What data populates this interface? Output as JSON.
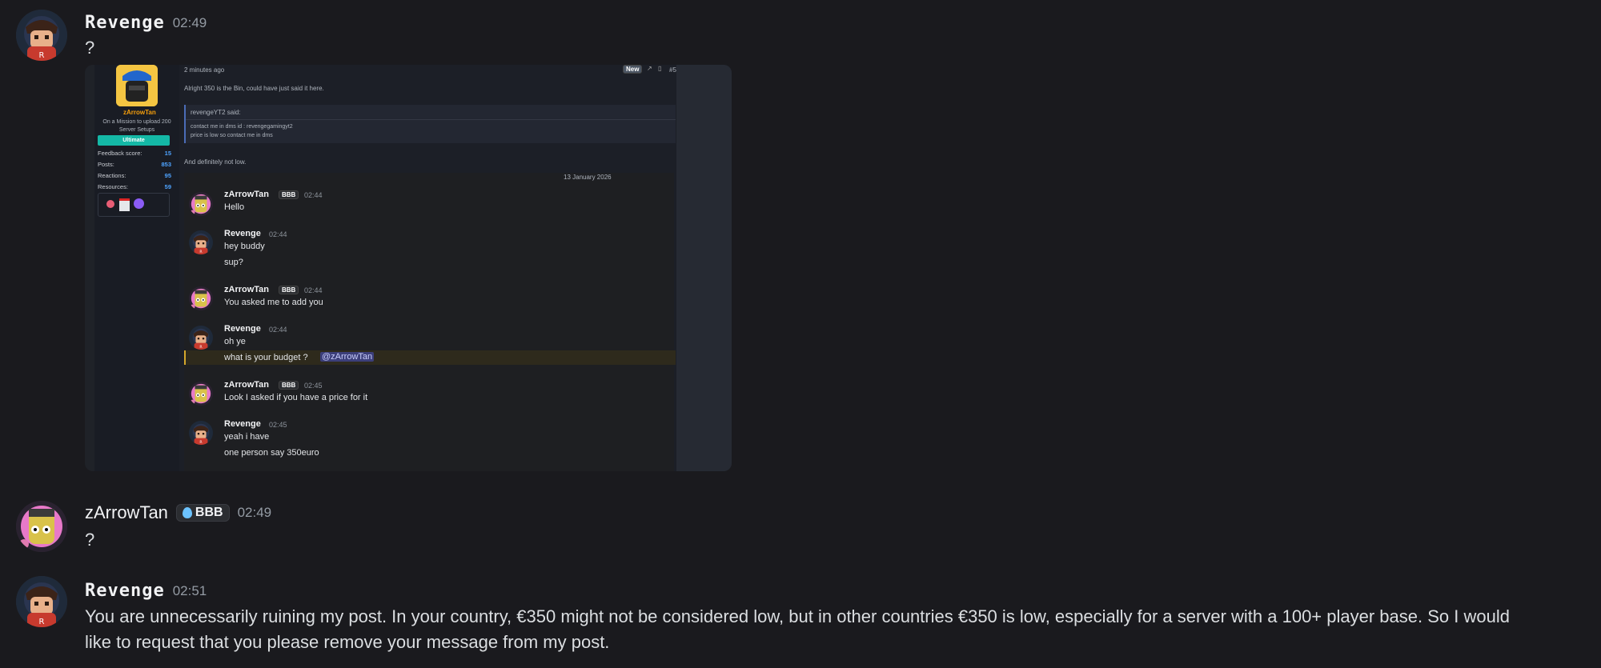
{
  "messages": [
    {
      "author": "Revenge",
      "time": "02:49",
      "text": "?"
    },
    {
      "author": "zArrowTan",
      "tag": "BBB",
      "time": "02:49",
      "text": "?"
    },
    {
      "author": "Revenge",
      "time": "02:51",
      "text_line1": "You are unnecessarily ruining my post. In your country, €350 might not be considered low, but in other countries €350 is low, especially for a server with a 100+ player base. So I would",
      "text_line2": "like to request that you please remove your message from my post."
    }
  ],
  "embed": {
    "profile": {
      "name": "zArrowTan",
      "subtitle_line1": "On a Mission to upload 200",
      "subtitle_line2": "Server Setups",
      "rank": "Ultimate",
      "stats": [
        {
          "label": "Feedback score:",
          "value": "15"
        },
        {
          "label": "Posts:",
          "value": "853"
        },
        {
          "label": "Reactions:",
          "value": "95"
        },
        {
          "label": "Resources:",
          "value": "59"
        }
      ]
    },
    "post": {
      "time_ago": "2 minutes ago",
      "new_badge": "New",
      "post_number": "#5",
      "line1": "Alright 350 is the Bin, could have just said it here.",
      "quote_author": "revengeYT2 said:",
      "quote_line1": "contact me in dms id : revengegamingyt2",
      "quote_line2": "price is low so contact me in dms",
      "line2": "And definitely not low.",
      "date_divider": "13 January 2026"
    },
    "chat": [
      {
        "author": "zArrowTan",
        "tag": "BBB",
        "time": "02:44",
        "lines": [
          "Hello"
        ]
      },
      {
        "author": "Revenge",
        "time": "02:44",
        "lines": [
          "hey buddy",
          "sup?"
        ]
      },
      {
        "author": "zArrowTan",
        "tag": "BBB",
        "time": "02:44",
        "lines": [
          "You asked me to add you"
        ]
      },
      {
        "author": "Revenge",
        "time": "02:44",
        "lines": [
          "oh ye",
          "what is your budget ?"
        ],
        "mention": "@zArrowTan"
      },
      {
        "author": "zArrowTan",
        "tag": "BBB",
        "time": "02:45",
        "lines": [
          "Look I asked if you have a price for it"
        ]
      },
      {
        "author": "Revenge",
        "time": "02:45",
        "lines": [
          "yeah i have",
          "one person say 350euro"
        ]
      }
    ]
  },
  "colors": {
    "background": "#1a1a1e",
    "mention_bg": "#3c3f7a",
    "highlight_row": "#2e2a1c",
    "accent_teal": "#14b8a6"
  }
}
